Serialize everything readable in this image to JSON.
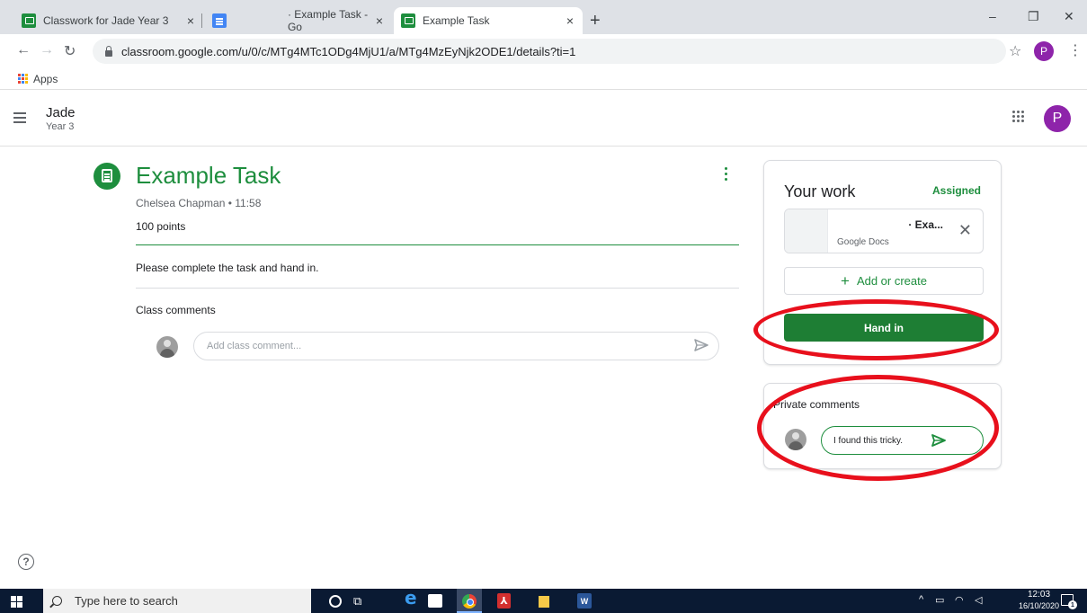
{
  "browser": {
    "tabs": [
      {
        "title": "Classwork for Jade Year 3",
        "close": "×"
      },
      {
        "title": "· Example Task - Go",
        "close": "×"
      },
      {
        "title": "Example Task",
        "close": "×"
      }
    ],
    "new_tab": "+",
    "window_controls": {
      "minimize": "–",
      "maximize": "❐",
      "close": "✕"
    },
    "url": "classroom.google.com/u/0/c/MTg4MTc1ODg4MjU1/a/MTg4MzEyNjk2ODE1/details?ti=1",
    "profile_initial": "P",
    "bookmarks": {
      "apps_label": "Apps"
    }
  },
  "classroom": {
    "class_name": "Jade",
    "class_section": "Year 3",
    "account_initial": "P"
  },
  "assignment": {
    "title": "Example Task",
    "author_time": "Chelsea Chapman • 11:58",
    "points": "100 points",
    "description": "Please complete the task and hand in.",
    "class_comments_label": "Class comments",
    "comment_placeholder": "Add class comment..."
  },
  "your_work": {
    "title": "Your work",
    "status": "Assigned",
    "attachment": {
      "name": "· Exa...",
      "type": "Google Docs"
    },
    "add_or_create": "Add or create",
    "hand_in": "Hand in"
  },
  "private_comments": {
    "label": "Private comments",
    "value": "I found this tricky."
  },
  "help": "?",
  "taskbar": {
    "search_placeholder": "Type here to search",
    "time": "12:03",
    "date": "16/10/2020",
    "notification_count": "1"
  },
  "colors": {
    "accent": "#1e8e3e",
    "hand_in_button": "#1e7e34",
    "annotation": "#e8101c",
    "avatar": "#8e24aa"
  }
}
